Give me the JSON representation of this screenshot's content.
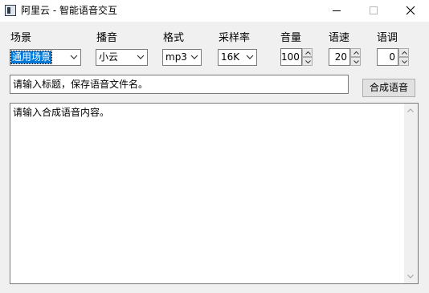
{
  "window": {
    "title": "阿里云 - 智能语音交互",
    "icon": "app-window-icon"
  },
  "labels": {
    "scene": "场景",
    "voice": "播音",
    "format": "格式",
    "sample_rate": "采样率",
    "volume": "音量",
    "speed": "语速",
    "pitch": "语调"
  },
  "selects": {
    "scene": "通用场景",
    "voice": "小云",
    "format": "mp3",
    "sample_rate": "16K"
  },
  "spinners": {
    "volume": "100",
    "speed": "20",
    "pitch": "0"
  },
  "title_field": {
    "placeholder": "请输入标题，保存语音文件名。"
  },
  "synthesize_button": "合成语音",
  "content_field": {
    "placeholder": "请输入合成语音内容。"
  }
}
